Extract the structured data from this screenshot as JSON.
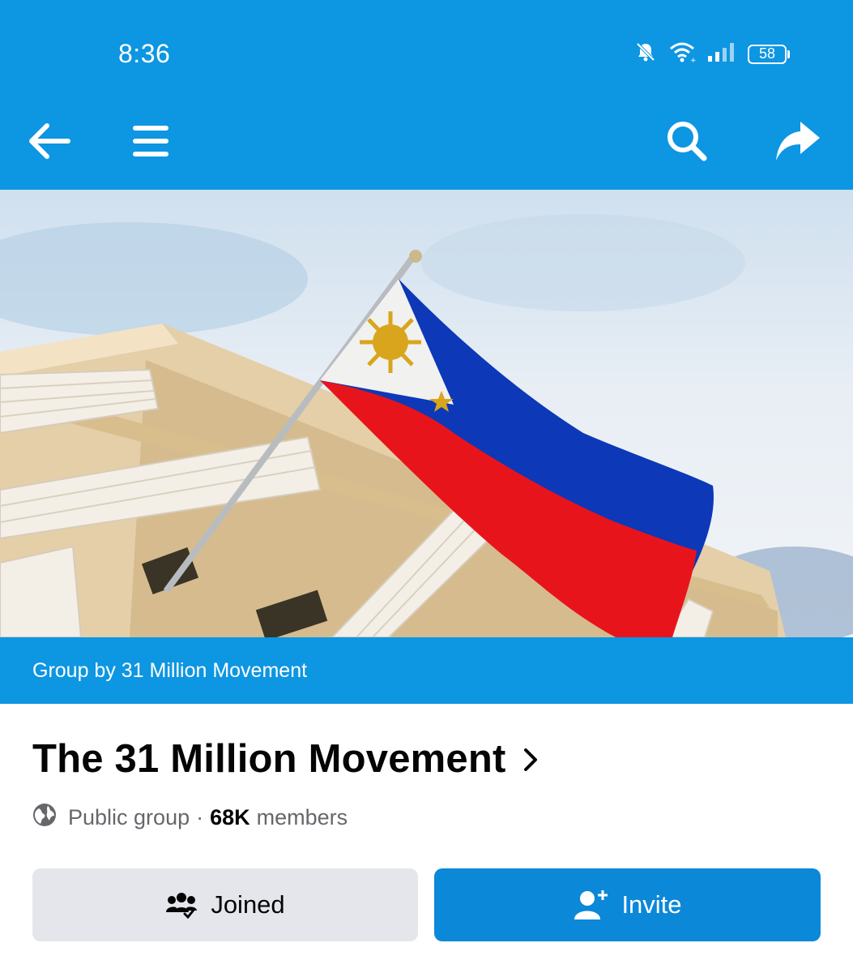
{
  "status_bar": {
    "time": "8:36",
    "battery": "58",
    "icons": [
      "notifications-off-icon",
      "wifi-icon",
      "signal-icon",
      "battery-icon"
    ]
  },
  "top_bar": {
    "icons": [
      "back-arrow-icon",
      "menu-icon",
      "search-icon",
      "share-icon"
    ],
    "color": "#0d96e2"
  },
  "cover": {
    "description_icon": "cover-photo"
  },
  "group_by": "Group by 31 Million Movement",
  "group": {
    "title": "The 31 Million Movement",
    "privacy": "Public group",
    "separator": "·",
    "member_count": "68K",
    "member_label": "members"
  },
  "actions": {
    "joined_label": "Joined",
    "invite_label": "Invite"
  },
  "colors": {
    "accent": "#0d96e2",
    "invite_button": "#0b88d8",
    "joined_button": "#e4e6eb"
  }
}
